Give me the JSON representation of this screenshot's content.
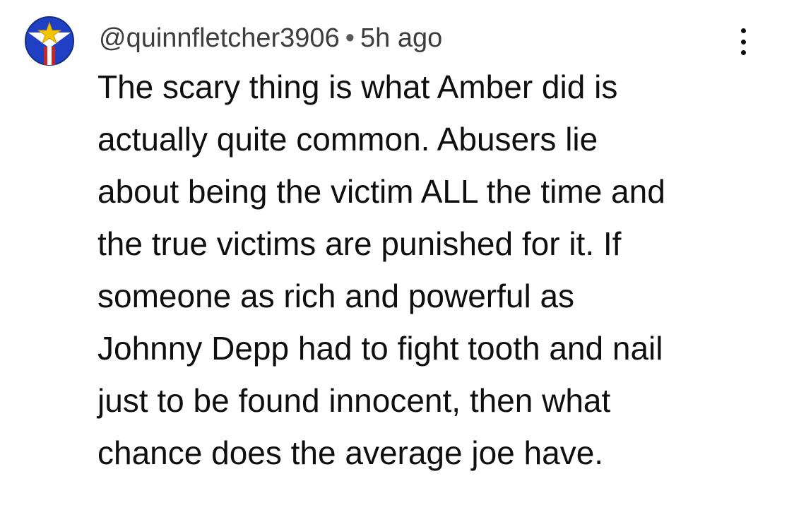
{
  "comment": {
    "author": "@quinnfletcher3906",
    "separator": "•",
    "timestamp": "5h ago",
    "text_lines": [
      "The scary thing is what Amber did is",
      "actually quite common. Abusers lie",
      "about being the victim ALL the time and",
      "the true victims are punished for it. If",
      "someone as rich and powerful as",
      "Johnny Depp had to fight tooth and nail",
      "just to be found innocent, then what",
      "chance does the average joe have."
    ],
    "more_icon": "vertical-ellipsis-icon",
    "avatar_icon": "star-emblem-avatar"
  },
  "colors": {
    "avatar_blue": "#1f3fc4",
    "avatar_yellow": "#f4c400",
    "avatar_red": "#c62828",
    "text": "#0f0f0f",
    "meta": "#3d3d3d"
  }
}
